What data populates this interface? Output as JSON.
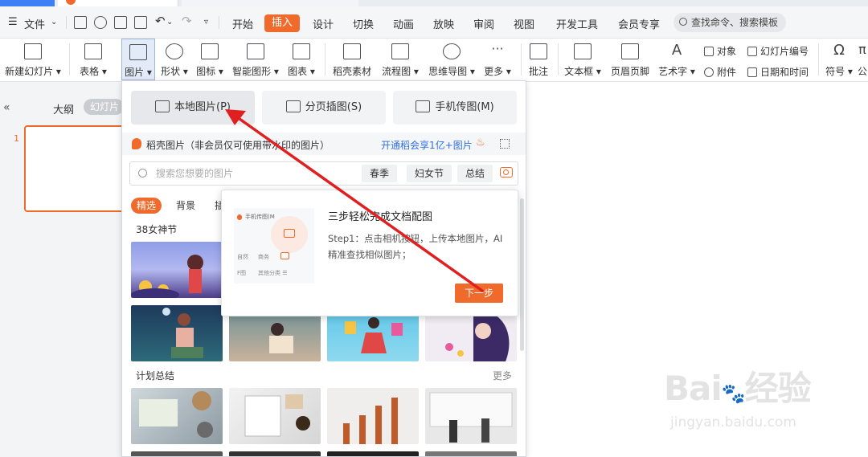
{
  "menubar": {
    "file": "文件",
    "tabs": [
      "开始",
      "插入",
      "设计",
      "切换",
      "动画",
      "放映",
      "审阅",
      "视图",
      "开发工具",
      "会员专享"
    ],
    "active_tab": "插入",
    "search": "查找命令、搜索模板"
  },
  "ribbon": {
    "new_slide": "新建幻灯片",
    "table": "表格",
    "picture": "图片",
    "shape": "形状",
    "icon": "图标",
    "smart_graphic": "智能图形",
    "chart": "图表",
    "daoke_material": "稻壳素材",
    "flowchart": "流程图",
    "mindmap": "思维导图",
    "more": "更多",
    "comment": "批注",
    "textbox": "文本框",
    "header_footer": "页眉页脚",
    "wordart": "艺术字",
    "object": "对象",
    "slide_number": "幻灯片编号",
    "attachment": "附件",
    "datetime": "日期和时间",
    "symbol": "符号",
    "formula": "公"
  },
  "leftpane": {
    "outline": "大纲",
    "slides": "幻灯片",
    "slide_number": "1"
  },
  "panel": {
    "sources": [
      "本地图片(P)",
      "分页插图(S)",
      "手机传图(M)"
    ],
    "daoke_text": "稻壳图片（非会员仅可使用带水印的图片）",
    "upgrade_link": "开通稻会享1亿+图片",
    "search_placeholder": "搜索您想要的图片",
    "chips": [
      "春季",
      "妇女节",
      "总结"
    ],
    "categories": [
      "精选",
      "背景",
      "插"
    ],
    "section1": "38女神节",
    "section2": "计划总结",
    "more": "更多"
  },
  "popover": {
    "title": "三步轻松完成文档配图",
    "body": "Step1：点击相机按钮，上传本地图片，AI精准查找相似图片；",
    "next": "下一步",
    "art_label": "手机传图(M",
    "art_tags": [
      "自然",
      "商务"
    ],
    "art_bottom": [
      "F图",
      "其他分类 ☰"
    ]
  },
  "watermark": {
    "logo": "Bai经验",
    "url": "jingyan.baidu.com"
  },
  "colors": {
    "accent": "#f06a2b",
    "link": "#2f6fe0",
    "arrow": "#e02020"
  }
}
